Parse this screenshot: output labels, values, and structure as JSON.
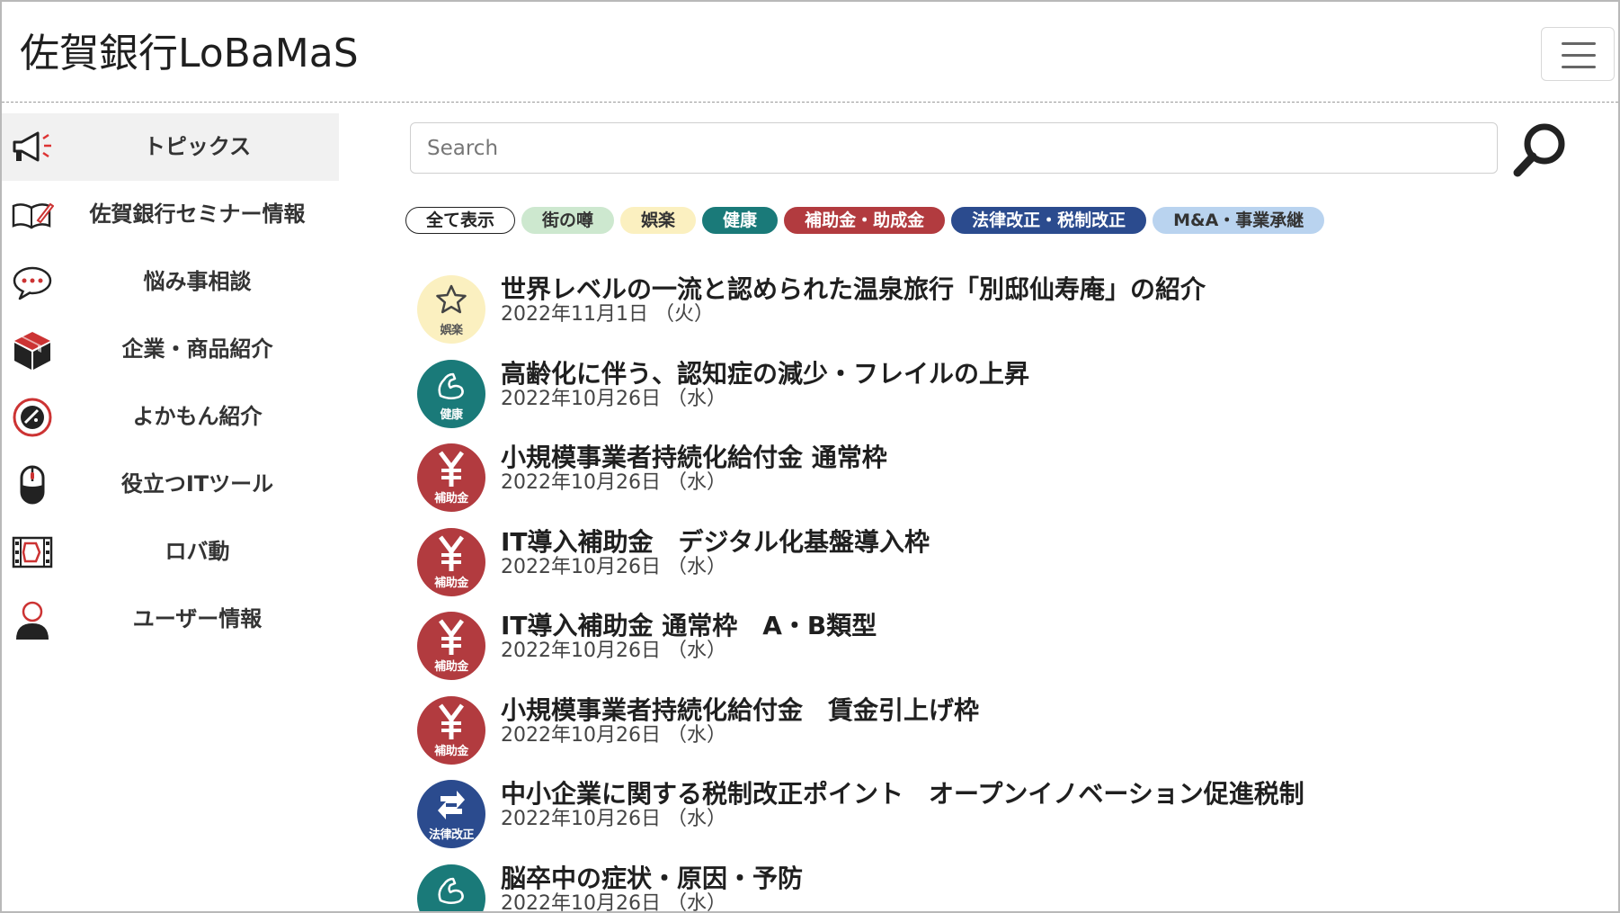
{
  "app": {
    "title": "佐賀銀行LoBaMaS"
  },
  "sidebar": {
    "items": [
      {
        "label": "トピックス",
        "icon": "megaphone-icon",
        "active": true
      },
      {
        "label": "佐賀銀行セミナー情報",
        "icon": "notebook-pen-icon"
      },
      {
        "label": "悩み事相談",
        "icon": "chat-bubble-icon"
      },
      {
        "label": "企業・商品紹介",
        "icon": "package-icon"
      },
      {
        "label": "よかもん紹介",
        "icon": "badge-icon"
      },
      {
        "label": "役立つITツール",
        "icon": "mouse-icon"
      },
      {
        "label": "ロバ動",
        "icon": "film-icon"
      },
      {
        "label": "ユーザー情報",
        "icon": "user-icon"
      }
    ]
  },
  "search": {
    "placeholder": "Search"
  },
  "filters": [
    {
      "label": "全て表示",
      "bg": "#ffffff",
      "fg": "#222222",
      "border": "#222222"
    },
    {
      "label": "街の噂",
      "bg": "#cde8cf",
      "fg": "#333333"
    },
    {
      "label": "娯楽",
      "bg": "#fbf0c0",
      "fg": "#333333"
    },
    {
      "label": "健康",
      "bg": "#1a7a79",
      "fg": "#ffffff"
    },
    {
      "label": "補助金・助成金",
      "bg": "#b23b3f",
      "fg": "#ffffff"
    },
    {
      "label": "法律改正・税制改正",
      "bg": "#2b4b8e",
      "fg": "#ffffff"
    },
    {
      "label": "M&A・事業承継",
      "bg": "#b9d3ef",
      "fg": "#333333"
    }
  ],
  "articles": [
    {
      "title": "世界レベルの一流と認められた温泉旅行「別邸仙寿庵」の紹介",
      "date": "2022年11月1日 （火）",
      "category": "娯楽",
      "icon": "star-icon",
      "color": "#fbf0c0"
    },
    {
      "title": "高齢化に伴う、認知症の減少・フレイルの上昇",
      "date": "2022年10月26日 （水）",
      "category": "健康",
      "icon": "muscle-arm-icon",
      "color": "#1a7a79"
    },
    {
      "title": "小規模事業者持続化給付金 通常枠",
      "date": "2022年10月26日 （水）",
      "category": "補助金",
      "icon": "yen-icon",
      "color": "#b23b3f"
    },
    {
      "title": "IT導入補助金　デジタル化基盤導入枠",
      "date": "2022年10月26日 （水）",
      "category": "補助金",
      "icon": "yen-icon",
      "color": "#b23b3f"
    },
    {
      "title": "IT導入補助金 通常枠　A・B類型",
      "date": "2022年10月26日 （水）",
      "category": "補助金",
      "icon": "yen-icon",
      "color": "#b23b3f"
    },
    {
      "title": "小規模事業者持続化給付金　賃金引上げ枠",
      "date": "2022年10月26日 （水）",
      "category": "補助金",
      "icon": "yen-icon",
      "color": "#b23b3f"
    },
    {
      "title": "中小企業に関する税制改正ポイント　オープンイノベーション促進税制",
      "date": "2022年10月26日 （水）",
      "category": "法律改正",
      "icon": "refresh-icon",
      "color": "#2b4b8e"
    },
    {
      "title": "脳卒中の症状・原因・予防",
      "date": "2022年10月26日 （水）",
      "category": "健康",
      "icon": "muscle-arm-icon",
      "color": "#1a7a79"
    }
  ]
}
